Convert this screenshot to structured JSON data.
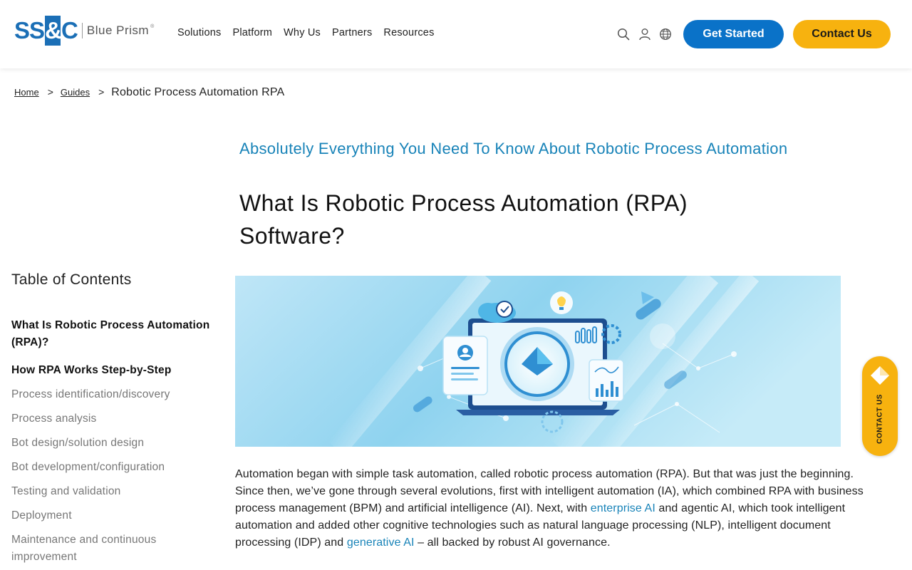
{
  "brand": {
    "logo_left": "SS",
    "logo_amp": "&",
    "logo_right": "C",
    "logo_product": "Blue Prism",
    "logo_reg": "®",
    "colors": {
      "primary": "#0a72c8",
      "accent": "#f7b20f",
      "link": "#1883b8"
    }
  },
  "nav": {
    "items": [
      "Solutions",
      "Platform",
      "Why Us",
      "Partners",
      "Resources"
    ]
  },
  "header_icons": [
    "search-icon",
    "user-icon",
    "globe-icon"
  ],
  "buttons": {
    "get_started": "Get Started",
    "contact_us": "Contact Us"
  },
  "breadcrumb": {
    "home": "Home",
    "sep": ">",
    "guides": "Guides",
    "current": "Robotic Process Automation RPA"
  },
  "main": {
    "eyebrow": "Absolutely Everything You Need To Know About Robotic Process Automation",
    "title": "What Is Robotic Process Automation (RPA) Software?"
  },
  "toc": {
    "title": "Table of Contents",
    "sections": [
      "What Is Robotic Process Automation (RPA)?",
      "How RPA Works Step-by-Step"
    ],
    "subitems": [
      "Process identification/discovery",
      "Process analysis",
      "Bot design/solution design",
      "Bot development/configuration",
      "Testing and validation",
      "Deployment",
      "Maintenance and continuous improvement"
    ]
  },
  "paragraph": {
    "part1": "Automation began with simple task automation, called robotic process automation (RPA). But that was just the beginning. Since then, we’ve gone through several evolutions, first with intelligent automation (IA), which combined RPA with business process management (BPM) and artificial intelligence (AI). Next, with ",
    "link1": "enterprise AI",
    "part2": " and agentic AI, which took intelligent automation and added other cognitive technologies such as natural language processing (NLP), intelligent document processing (IDP) and ",
    "link2": "generative AI",
    "part3": " – all backed by robust AI governance."
  },
  "float_tab": {
    "label": "CONTACT US"
  }
}
